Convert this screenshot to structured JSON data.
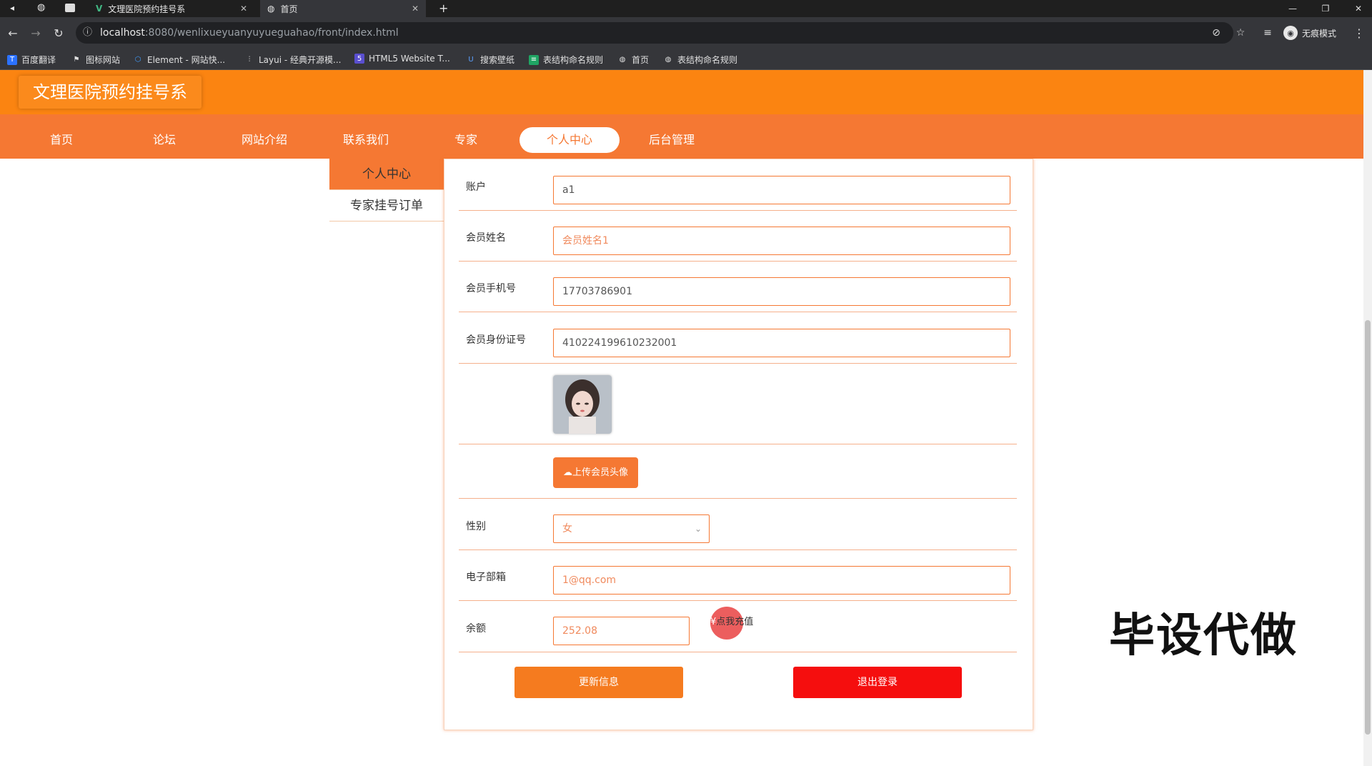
{
  "browser": {
    "tabs": [
      {
        "title": "文理医院预约挂号系",
        "active": false
      },
      {
        "title": "首页",
        "active": true
      }
    ],
    "url_host": "localhost",
    "url_path": ":8080/wenlixueyuanyuyueguahao/front/index.html",
    "profile_label": "无痕模式",
    "bookmarks": [
      "百度翻译",
      "图标网站",
      "Element - 网站快...",
      "Layui - 经典开源模...",
      "HTML5 Website T...",
      "搜索壁纸",
      "表结构命名规则",
      "首页",
      "表结构命名规则"
    ]
  },
  "site": {
    "title": "文理医院预约挂号系",
    "nav": [
      "首页",
      "论坛",
      "网站介绍",
      "联系我们",
      "专家",
      "个人中心",
      "后台管理"
    ],
    "nav_active": "个人中心"
  },
  "sidebar": {
    "items": [
      "个人中心",
      "专家挂号订单"
    ]
  },
  "form": {
    "account_label": "账户",
    "account_value": "a1",
    "name_label": "会员姓名",
    "name_placeholder": "会员姓名1",
    "phone_label": "会员手机号",
    "phone_value": "17703786901",
    "idcard_label": "会员身份证号",
    "idcard_value": "410224199610232001",
    "upload_label": "上传会员头像",
    "gender_label": "性别",
    "gender_value": "女",
    "email_label": "电子部箱",
    "email_value": "1@qq.com",
    "balance_label": "余额",
    "balance_value": "252.08",
    "recharge_label": "点我充值",
    "update_button": "更新信息",
    "logout_button": "退出登录"
  },
  "watermark": "毕设代做",
  "colors": {
    "header": "#fb8411",
    "nav": "#f57833",
    "logout": "#f50e0e"
  }
}
